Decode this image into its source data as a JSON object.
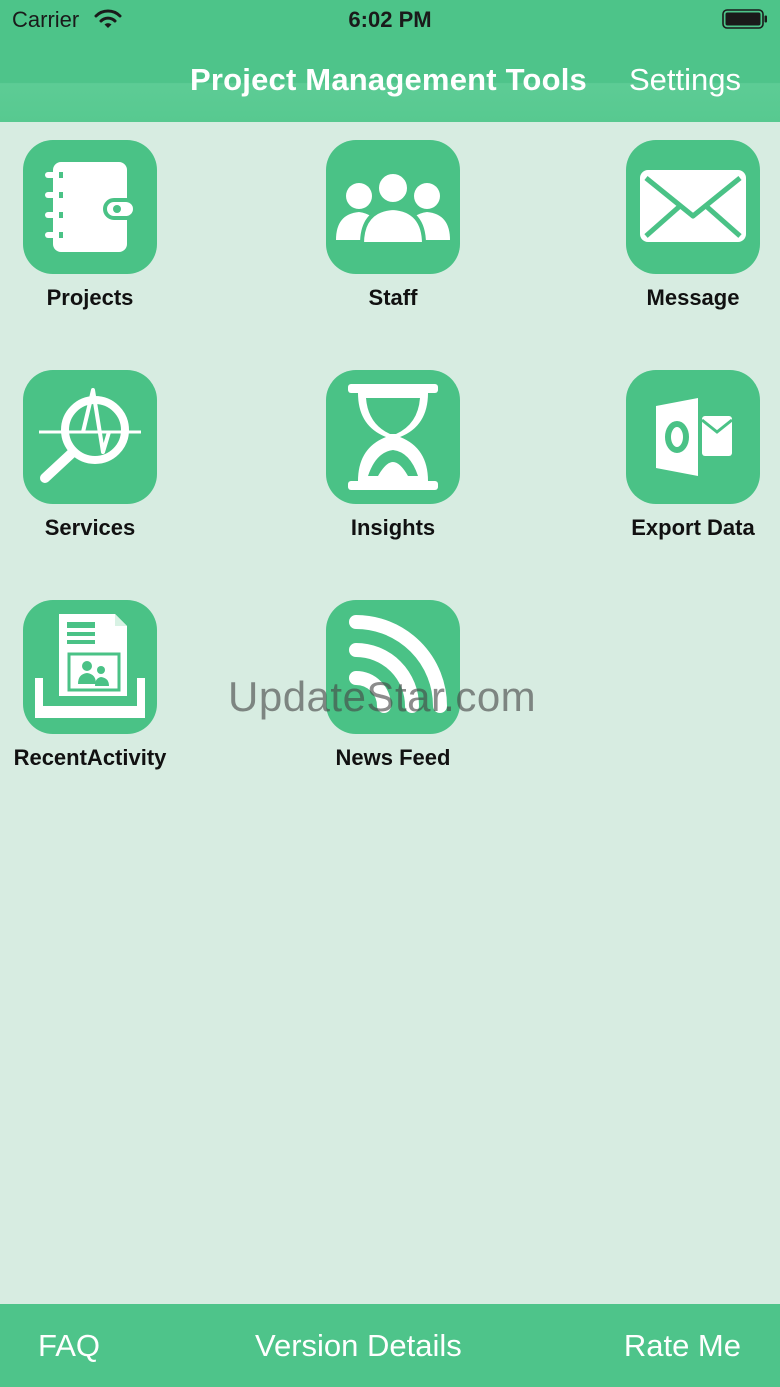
{
  "status_bar": {
    "carrier": "Carrier",
    "time": "6:02 PM"
  },
  "nav": {
    "title": "Project Management Tools",
    "settings_label": "Settings"
  },
  "tiles": [
    {
      "label": "Projects",
      "icon": "notebook-icon"
    },
    {
      "label": "Staff",
      "icon": "people-icon"
    },
    {
      "label": "Message",
      "icon": "envelope-icon"
    },
    {
      "label": "Services",
      "icon": "magnifier-pulse-icon"
    },
    {
      "label": "Insights",
      "icon": "hourglass-icon"
    },
    {
      "label": "Export Data",
      "icon": "outlook-icon"
    },
    {
      "label": "RecentActivity",
      "icon": "document-tray-icon"
    },
    {
      "label": "News Feed",
      "icon": "rss-icon"
    }
  ],
  "watermark": "UpdateStar.com",
  "bottom_bar": {
    "faq": "FAQ",
    "version_details": "Version Details",
    "rate_me": "Rate Me"
  },
  "colors": {
    "accent": "#4ec48a",
    "background": "#d7ece1",
    "label": "#111111"
  }
}
